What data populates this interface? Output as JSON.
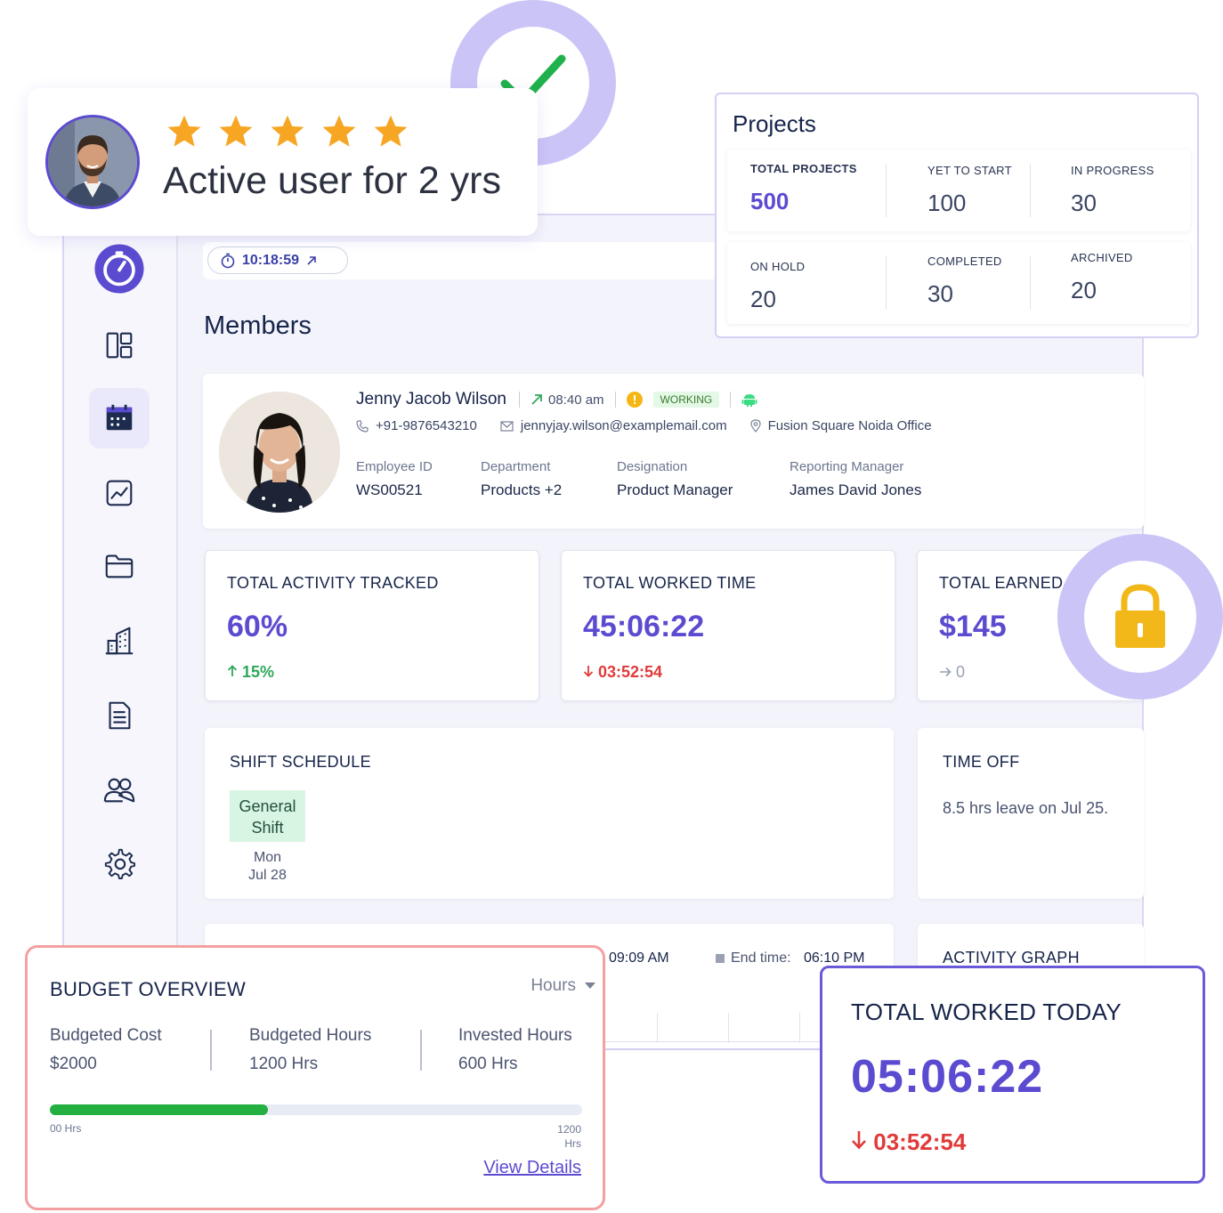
{
  "rating": {
    "text": "Active user for 2 yrs",
    "stars": 5,
    "star_color": "#f6a623"
  },
  "timer": {
    "value": "10:18:59"
  },
  "members": {
    "title": "Members"
  },
  "profile": {
    "name": "Jenny Jacob Wilson",
    "clock_in": "08:40 am",
    "status": "WORKING",
    "phone": "+91-9876543210",
    "email": "jennyjay.wilson@examplemail.com",
    "location": "Fusion Square Noida Office",
    "fields": [
      {
        "label": "Employee ID",
        "value": "WS00521"
      },
      {
        "label": "Department",
        "value": "Products +2"
      },
      {
        "label": "Designation",
        "value": "Product Manager"
      },
      {
        "label": "Reporting Manager",
        "value": "James David Jones"
      }
    ]
  },
  "stats": [
    {
      "title": "TOTAL ACTIVITY TRACKED",
      "value": "60%",
      "delta": "15%",
      "trend": "up"
    },
    {
      "title": "TOTAL WORKED TIME",
      "value": "45:06:22",
      "delta": "03:52:54",
      "trend": "down"
    },
    {
      "title": "TOTAL EARNED",
      "value": "$145",
      "delta": "0",
      "trend": "flat"
    }
  ],
  "shift": {
    "title": "SHIFT SCHEDULE",
    "chip": "General Shift",
    "day": "Mon",
    "date": "Jul 28"
  },
  "time_off": {
    "title": "TIME OFF",
    "text": "8.5 hrs leave on Jul 25."
  },
  "bottom": {
    "start_time": "09:09 AM",
    "end_label": "End time:",
    "end_time": "06:10 PM",
    "activity_title": "ACTIVITY GRAPH"
  },
  "projects": {
    "title": "Projects",
    "items": [
      {
        "label": "TOTAL PROJECTS",
        "value": "500"
      },
      {
        "label": "YET TO START",
        "value": "100"
      },
      {
        "label": "IN PROGRESS",
        "value": "30"
      },
      {
        "label": "ON HOLD",
        "value": "20"
      },
      {
        "label": "COMPLETED",
        "value": "30"
      },
      {
        "label": "ARCHIVED",
        "value": "20"
      }
    ]
  },
  "budget": {
    "title": "BUDGET OVERVIEW",
    "unit_select": "Hours",
    "columns": [
      {
        "label": "Budgeted Cost",
        "value": "$2000"
      },
      {
        "label": "Budgeted Hours",
        "value": "1200 Hrs"
      },
      {
        "label": "Invested Hours",
        "value": "600 Hrs"
      }
    ],
    "progress_fraction": 0.41,
    "min_label": "00 Hrs",
    "max_label_top": "1200",
    "max_label_bottom": "Hrs",
    "link": "View Details"
  },
  "today": {
    "title": "TOTAL WORKED TODAY",
    "value": "05:06:22",
    "delta": "03:52:54"
  },
  "colors": {
    "accent": "#5b4bd0",
    "positive": "#2fa85a",
    "negative": "#e03b3b",
    "lock": "#f2b81a",
    "check": "#1fb14b"
  },
  "sidebar": {
    "icons": [
      "timer-icon",
      "dashboard-icon",
      "calendar-icon",
      "chart-icon",
      "folder-icon",
      "building-icon",
      "document-icon",
      "users-icon",
      "settings-icon"
    ]
  }
}
